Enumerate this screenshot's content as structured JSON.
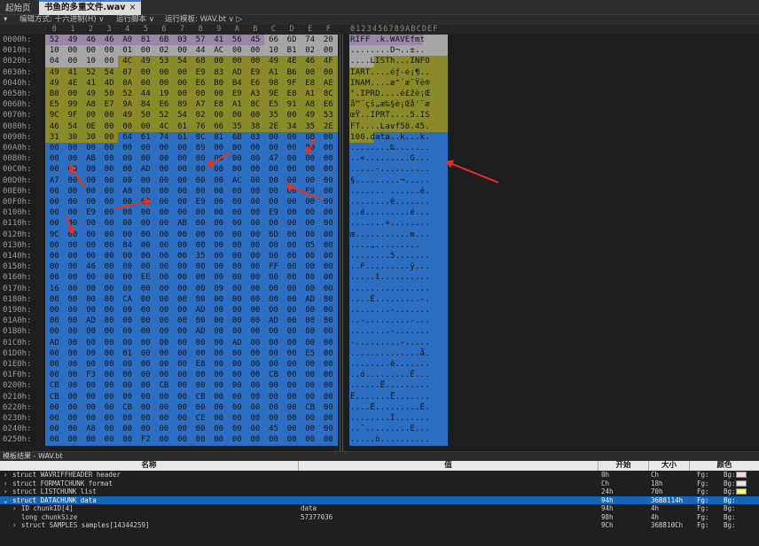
{
  "tabs": [
    {
      "label": "起始页"
    },
    {
      "label": "书鱼的多重文件.wav",
      "close": "×"
    }
  ],
  "toolbar": {
    "edit_mode": "编辑方式: 十六进制(H) ∨",
    "run_script": "运行脚本 ∨",
    "run_template": "运行模板: WAV.bt ∨ ▷"
  },
  "hex": {
    "col_headers": [
      "0",
      "1",
      "2",
      "3",
      "4",
      "5",
      "6",
      "7",
      "8",
      "9",
      "A",
      "B",
      "C",
      "D",
      "E",
      "F"
    ],
    "ascii_header": "0123456789ABCDEF",
    "rows": [
      {
        "off": "0000h:",
        "b": [
          "52",
          "49",
          "46",
          "46",
          "A0",
          "81",
          "6B",
          "03",
          "57",
          "41",
          "56",
          "45",
          "66",
          "6D",
          "74",
          "20"
        ],
        "a": "RIFF .k.WAVEfmt "
      },
      {
        "off": "0010h:",
        "b": [
          "10",
          "00",
          "00",
          "00",
          "01",
          "00",
          "02",
          "00",
          "44",
          "AC",
          "00",
          "00",
          "10",
          "B1",
          "02",
          "00"
        ],
        "a": "........D¬..±.."
      },
      {
        "off": "0020h:",
        "b": [
          "04",
          "00",
          "10",
          "00",
          "4C",
          "49",
          "53",
          "54",
          "68",
          "00",
          "00",
          "00",
          "49",
          "4E",
          "46",
          "4F"
        ],
        "a": "....LISTh...INFO"
      },
      {
        "off": "0030h:",
        "b": [
          "49",
          "41",
          "52",
          "54",
          "07",
          "00",
          "00",
          "00",
          "E9",
          "83",
          "AD",
          "E9",
          "A1",
          "B6",
          "00",
          "00"
        ],
        "a": "IART....éƒ-é¡¶.."
      },
      {
        "off": "0040h:",
        "b": [
          "49",
          "4E",
          "41",
          "4D",
          "0A",
          "00",
          "00",
          "00",
          "E6",
          "B0",
          "B4",
          "E6",
          "98",
          "9F",
          "E8",
          "AE"
        ],
        "a": "INAM....æ°´æ˜Ÿè®"
      },
      {
        "off": "0050h:",
        "b": [
          "B0",
          "00",
          "49",
          "50",
          "52",
          "44",
          "19",
          "00",
          "00",
          "00",
          "E9",
          "A3",
          "9E",
          "E8",
          "A1",
          "8C"
        ],
        "a": "°.IPRD....é£žè¡Œ"
      },
      {
        "off": "0060h:",
        "b": [
          "E5",
          "99",
          "A8",
          "E7",
          "9A",
          "84",
          "E6",
          "89",
          "A7",
          "E8",
          "A1",
          "8C",
          "E5",
          "91",
          "A8",
          "E6"
        ],
        "a": "å™¨çš„æ‰§è¡Œå'¨æ"
      },
      {
        "off": "0070h:",
        "b": [
          "9C",
          "9F",
          "00",
          "00",
          "49",
          "50",
          "52",
          "54",
          "02",
          "00",
          "00",
          "00",
          "35",
          "00",
          "49",
          "53"
        ],
        "a": "œŸ..IPRT....5.IS"
      },
      {
        "off": "0080h:",
        "b": [
          "46",
          "54",
          "0E",
          "00",
          "00",
          "00",
          "4C",
          "61",
          "76",
          "66",
          "35",
          "38",
          "2E",
          "34",
          "35",
          "2E"
        ],
        "a": "FT....Lavf58.45."
      },
      {
        "off": "0090h:",
        "b": [
          "31",
          "30",
          "30",
          "00",
          "64",
          "61",
          "74",
          "61",
          "0C",
          "81",
          "6B",
          "03",
          "00",
          "00",
          "6B",
          "00"
        ],
        "a": "100.data..k...k."
      },
      {
        "off": "00A0h:",
        "b": [
          "00",
          "00",
          "00",
          "00",
          "00",
          "00",
          "00",
          "00",
          "89",
          "00",
          "00",
          "00",
          "00",
          "00",
          "00",
          "00"
        ],
        "a": "........‰......."
      },
      {
        "off": "00B0h:",
        "b": [
          "00",
          "00",
          "AB",
          "00",
          "00",
          "00",
          "00",
          "00",
          "00",
          "00",
          "00",
          "00",
          "47",
          "00",
          "00",
          "00"
        ],
        "a": "..«.........G..."
      },
      {
        "off": "00C0h:",
        "b": [
          "00",
          "00",
          "00",
          "00",
          "00",
          "AD",
          "00",
          "00",
          "00",
          "00",
          "00",
          "00",
          "00",
          "00",
          "00",
          "00"
        ],
        "a": ".....-.........."
      },
      {
        "off": "00D0h:",
        "b": [
          "A7",
          "00",
          "00",
          "00",
          "00",
          "00",
          "00",
          "00",
          "00",
          "00",
          "AC",
          "00",
          "00",
          "00",
          "00",
          "00"
        ],
        "a": "§.........¬....."
      },
      {
        "off": "00E0h:",
        "b": [
          "00",
          "00",
          "00",
          "00",
          "A0",
          "00",
          "00",
          "00",
          "00",
          "00",
          "00",
          "00",
          "00",
          "00",
          "E9",
          "00"
        ],
        "a": "....... ......é."
      },
      {
        "off": "00F0h:",
        "b": [
          "00",
          "00",
          "00",
          "00",
          "00",
          "00",
          "00",
          "00",
          "E9",
          "00",
          "00",
          "00",
          "00",
          "00",
          "00",
          "00"
        ],
        "a": "........é......."
      },
      {
        "off": "0100h:",
        "b": [
          "00",
          "00",
          "E9",
          "00",
          "00",
          "00",
          "00",
          "00",
          "00",
          "00",
          "00",
          "00",
          "E9",
          "00",
          "00",
          "00"
        ],
        "a": "..é.........é..."
      },
      {
        "off": "0110h:",
        "b": [
          "00",
          "00",
          "00",
          "00",
          "00",
          "00",
          "00",
          "AB",
          "00",
          "00",
          "00",
          "00",
          "00",
          "00",
          "00",
          "00"
        ],
        "a": ".......«........"
      },
      {
        "off": "0120h:",
        "b": [
          "9C",
          "00",
          "00",
          "00",
          "00",
          "00",
          "00",
          "00",
          "00",
          "00",
          "00",
          "00",
          "6D",
          "00",
          "00",
          "00"
        ],
        "a": "œ...........m..."
      },
      {
        "off": "0130h:",
        "b": [
          "00",
          "00",
          "00",
          "00",
          "84",
          "00",
          "00",
          "00",
          "00",
          "00",
          "00",
          "00",
          "00",
          "00",
          "05",
          "00"
        ],
        "a": "....„........."
      },
      {
        "off": "0140h:",
        "b": [
          "00",
          "00",
          "00",
          "00",
          "00",
          "00",
          "00",
          "00",
          "35",
          "00",
          "00",
          "00",
          "00",
          "00",
          "00",
          "00"
        ],
        "a": "........5......."
      },
      {
        "off": "0150h:",
        "b": [
          "00",
          "00",
          "46",
          "00",
          "00",
          "00",
          "00",
          "00",
          "00",
          "00",
          "00",
          "00",
          "FF",
          "00",
          "00",
          "00"
        ],
        "a": "..F.........ÿ..."
      },
      {
        "off": "0160h:",
        "b": [
          "00",
          "00",
          "00",
          "00",
          "00",
          "EE",
          "00",
          "00",
          "00",
          "00",
          "00",
          "00",
          "00",
          "00",
          "00",
          "00"
        ],
        "a": ".....î.........."
      },
      {
        "off": "0170h:",
        "b": [
          "16",
          "00",
          "00",
          "00",
          "00",
          "00",
          "00",
          "00",
          "00",
          "09",
          "00",
          "00",
          "00",
          "00",
          "00",
          "00"
        ],
        "a": "................"
      },
      {
        "off": "0180h:",
        "b": [
          "00",
          "00",
          "00",
          "00",
          "CA",
          "00",
          "00",
          "00",
          "00",
          "00",
          "00",
          "00",
          "00",
          "00",
          "AD",
          "00"
        ],
        "a": "....Ê.........-."
      },
      {
        "off": "0190h:",
        "b": [
          "00",
          "00",
          "00",
          "00",
          "00",
          "00",
          "00",
          "00",
          "AD",
          "00",
          "00",
          "00",
          "00",
          "00",
          "00",
          "00"
        ],
        "a": "........-......."
      },
      {
        "off": "01A0h:",
        "b": [
          "00",
          "00",
          "AD",
          "00",
          "00",
          "00",
          "00",
          "00",
          "00",
          "00",
          "00",
          "00",
          "AD",
          "00",
          "00",
          "00"
        ],
        "a": "..-.........-..."
      },
      {
        "off": "01B0h:",
        "b": [
          "00",
          "00",
          "00",
          "00",
          "00",
          "00",
          "00",
          "00",
          "AD",
          "00",
          "00",
          "00",
          "00",
          "00",
          "00",
          "00"
        ],
        "a": "........-......."
      },
      {
        "off": "01C0h:",
        "b": [
          "AD",
          "00",
          "00",
          "00",
          "00",
          "00",
          "00",
          "00",
          "00",
          "00",
          "AD",
          "00",
          "00",
          "00",
          "00",
          "00"
        ],
        "a": "-.........-....."
      },
      {
        "off": "01D0h:",
        "b": [
          "00",
          "00",
          "00",
          "00",
          "01",
          "00",
          "00",
          "00",
          "00",
          "00",
          "00",
          "00",
          "00",
          "00",
          "E5",
          "00"
        ],
        "a": "..............å."
      },
      {
        "off": "01E0h:",
        "b": [
          "00",
          "00",
          "00",
          "00",
          "00",
          "00",
          "00",
          "00",
          "E8",
          "00",
          "00",
          "00",
          "00",
          "00",
          "00",
          "00"
        ],
        "a": "........è......."
      },
      {
        "off": "01F0h:",
        "b": [
          "00",
          "00",
          "F3",
          "00",
          "00",
          "00",
          "00",
          "00",
          "00",
          "00",
          "00",
          "00",
          "CB",
          "00",
          "00",
          "00"
        ],
        "a": "..ó.........Ë..."
      },
      {
        "off": "0200h:",
        "b": [
          "CB",
          "00",
          "00",
          "00",
          "00",
          "00",
          "CB",
          "00",
          "00",
          "00",
          "00",
          "00",
          "00",
          "00",
          "00",
          "00"
        ],
        "a": "......Ë........."
      },
      {
        "off": "0210h:",
        "b": [
          "CB",
          "00",
          "00",
          "00",
          "00",
          "00",
          "00",
          "00",
          "CB",
          "00",
          "00",
          "00",
          "00",
          "00",
          "00",
          "00"
        ],
        "a": "Ë.......Ë......."
      },
      {
        "off": "0220h:",
        "b": [
          "00",
          "00",
          "00",
          "00",
          "CB",
          "00",
          "00",
          "00",
          "00",
          "00",
          "00",
          "00",
          "00",
          "00",
          "CB",
          "00"
        ],
        "a": "....Ë.........Ë."
      },
      {
        "off": "0230h:",
        "b": [
          "00",
          "00",
          "00",
          "00",
          "00",
          "00",
          "00",
          "00",
          "CE",
          "00",
          "00",
          "00",
          "00",
          "00",
          "00",
          "00"
        ],
        "a": "........Î......."
      },
      {
        "off": "0240h:",
        "b": [
          "00",
          "00",
          "A8",
          "00",
          "00",
          "00",
          "00",
          "00",
          "00",
          "00",
          "00",
          "00",
          "45",
          "00",
          "00",
          "00"
        ],
        "a": "..¨.........E..."
      },
      {
        "off": "0250h:",
        "b": [
          "00",
          "00",
          "00",
          "00",
          "00",
          "F2",
          "00",
          "00",
          "00",
          "00",
          "00",
          "00",
          "00",
          "00",
          "00",
          "00"
        ],
        "a": ".....ò.........."
      }
    ]
  },
  "results": {
    "title": "模板结果 - WAV.bt",
    "headers": {
      "name": "名称",
      "value": "值",
      "start": "开始",
      "size": "大小",
      "color": "颜色"
    },
    "rows": [
      {
        "name": "struct WAVRIFFHEADER header",
        "value": "",
        "start": "0h",
        "size": "Ch",
        "fg": "Fg:",
        "bg": "Bg:",
        "swatch": "#f4d6ea",
        "indent": 0,
        "sel": false,
        "exp": "›"
      },
      {
        "name": "struct FORMATCHUNK format",
        "value": "",
        "start": "Ch",
        "size": "18h",
        "fg": "Fg:",
        "bg": "Bg:",
        "swatch": "#e6e6e6",
        "indent": 0,
        "sel": false,
        "exp": "›"
      },
      {
        "name": "struct LISTCHUNK list",
        "value": "",
        "start": "24h",
        "size": "70h",
        "fg": "Fg:",
        "bg": "Bg:",
        "swatch": "#f2f28c",
        "indent": 0,
        "sel": false,
        "exp": "›"
      },
      {
        "name": "struct DATACHUNK data",
        "value": "",
        "start": "94h",
        "size": "36B8114h",
        "fg": "Fg:",
        "bg": "Bg:",
        "swatch": "",
        "indent": 0,
        "sel": true,
        "exp": "⌄"
      },
      {
        "name": "ID chunkID[4]",
        "value": "data",
        "start": "94h",
        "size": "4h",
        "fg": "Fg:",
        "bg": "Bg:",
        "swatch": "",
        "indent": 1,
        "sel": false,
        "exp": "›"
      },
      {
        "name": "long chunkSize",
        "value": "57377036",
        "start": "98h",
        "size": "4h",
        "fg": "Fg:",
        "bg": "Bg:",
        "swatch": "",
        "indent": 1,
        "sel": false,
        "exp": ""
      },
      {
        "name": "struct SAMPLES samples[14344259]",
        "value": "",
        "start": "9Ch",
        "size": "36B810Ch",
        "fg": "Fg:",
        "bg": "Bg:",
        "swatch": "",
        "indent": 1,
        "sel": false,
        "exp": "›"
      }
    ]
  },
  "colors": {
    "header_bg": "#9a86a8",
    "fmt_bg": "#a6a6a6",
    "list_bg": "#8a8a2a",
    "data_bg": "#2c6fc2"
  }
}
